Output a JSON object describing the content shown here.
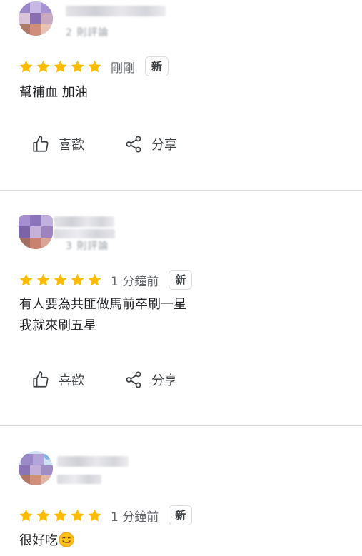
{
  "reviews": [
    {
      "rating": 5,
      "time": "剛剛",
      "badge": "新",
      "meta_text": "2 則評論",
      "comment_lines": [
        "幫補血 加油"
      ],
      "like_label": "喜歡",
      "share_label": "分享"
    },
    {
      "rating": 5,
      "time": "1 分鐘前",
      "badge": "新",
      "meta_text": "3 則評論",
      "comment_lines": [
        "有人要為共匪做馬前卒刷一星",
        "我就來刷五星"
      ],
      "like_label": "喜歡",
      "share_label": "分享"
    },
    {
      "rating": 5,
      "time": "1 分鐘前",
      "badge": "新",
      "comment_lines": [
        "很好吃"
      ],
      "comment_emoji": "yum-face-emoji"
    }
  ],
  "icons": {
    "star": "star-icon",
    "like": "thumbs-up-icon",
    "share": "share-icon"
  },
  "colors": {
    "star": "#FBBC04",
    "divider": "#DADCE0",
    "secondary_text": "#5F6368"
  }
}
